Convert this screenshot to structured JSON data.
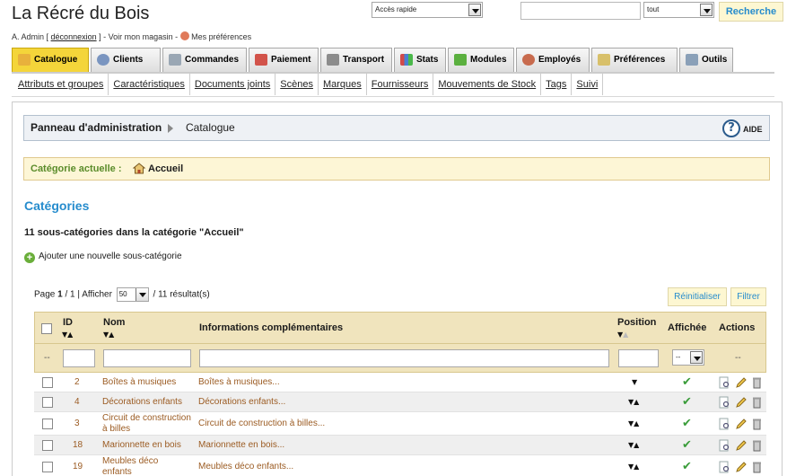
{
  "header": {
    "shop_name": "La Récré du Bois",
    "quick_access": "Accès rapide",
    "search_placeholder": "",
    "search_scope": "tout",
    "search_button": "Recherche",
    "user_name": "A. Admin",
    "logout": "déconnexion",
    "view_shop": "Voir mon magasin",
    "my_prefs": "Mes préférences"
  },
  "tabs": [
    {
      "label": "Catalogue",
      "active": true
    },
    {
      "label": "Clients"
    },
    {
      "label": "Commandes"
    },
    {
      "label": "Paiement"
    },
    {
      "label": "Transport"
    },
    {
      "label": "Stats"
    },
    {
      "label": "Modules"
    },
    {
      "label": "Employés"
    },
    {
      "label": "Préférences"
    },
    {
      "label": "Outils"
    }
  ],
  "subnav": [
    "Attributs et groupes",
    "Caractéristiques",
    "Documents joints",
    "Scènes",
    "Marques",
    "Fournisseurs",
    "Mouvements de Stock",
    "Tags",
    "Suivi"
  ],
  "breadcrumb": {
    "home": "Panneau d'administration",
    "current": "Catalogue",
    "help": "AIDE"
  },
  "current_category": {
    "label": "Catégorie actuelle :",
    "value": "Accueil"
  },
  "section": {
    "title": "Catégories",
    "count_text": "11 sous-catégories dans la catégorie \"Accueil\"",
    "add_link": "Ajouter une nouvelle sous-catégorie"
  },
  "pager": {
    "page_label": "Page",
    "current": "1",
    "total": "1",
    "show_label": "Afficher",
    "per_page": "50",
    "results": "/ 11 résultat(s)",
    "reset": "Réinitialiser",
    "filter": "Filtrer"
  },
  "table": {
    "headers": {
      "id": "ID",
      "name": "Nom",
      "info": "Informations complémentaires",
      "position": "Position",
      "displayed": "Affichée",
      "actions": "Actions"
    },
    "filter_dash": "--",
    "displayed_filter": "--",
    "actions_dash": "--",
    "rows": [
      {
        "id": "2",
        "name": "Boîtes à musiques",
        "info": "Boîtes à musiques...",
        "pos": "▼"
      },
      {
        "id": "4",
        "name": "Décorations enfants",
        "info": "Décorations enfants...",
        "pos": "▼▲"
      },
      {
        "id": "3",
        "name": "Circuit de construction à billes",
        "info": "Circuit de construction à billes...",
        "pos": "▼▲"
      },
      {
        "id": "18",
        "name": "Marionnette en bois",
        "info": "Marionnette en bois...",
        "pos": "▼▲"
      },
      {
        "id": "19",
        "name": "Meubles déco enfants",
        "info": "Meubles déco enfants...",
        "pos": "▼▲"
      }
    ]
  },
  "colors": {
    "accent": "#268ccd",
    "tab_active": "#f4d53a",
    "table_header": "#f0e4bd",
    "link_brown": "#9b5b22"
  }
}
